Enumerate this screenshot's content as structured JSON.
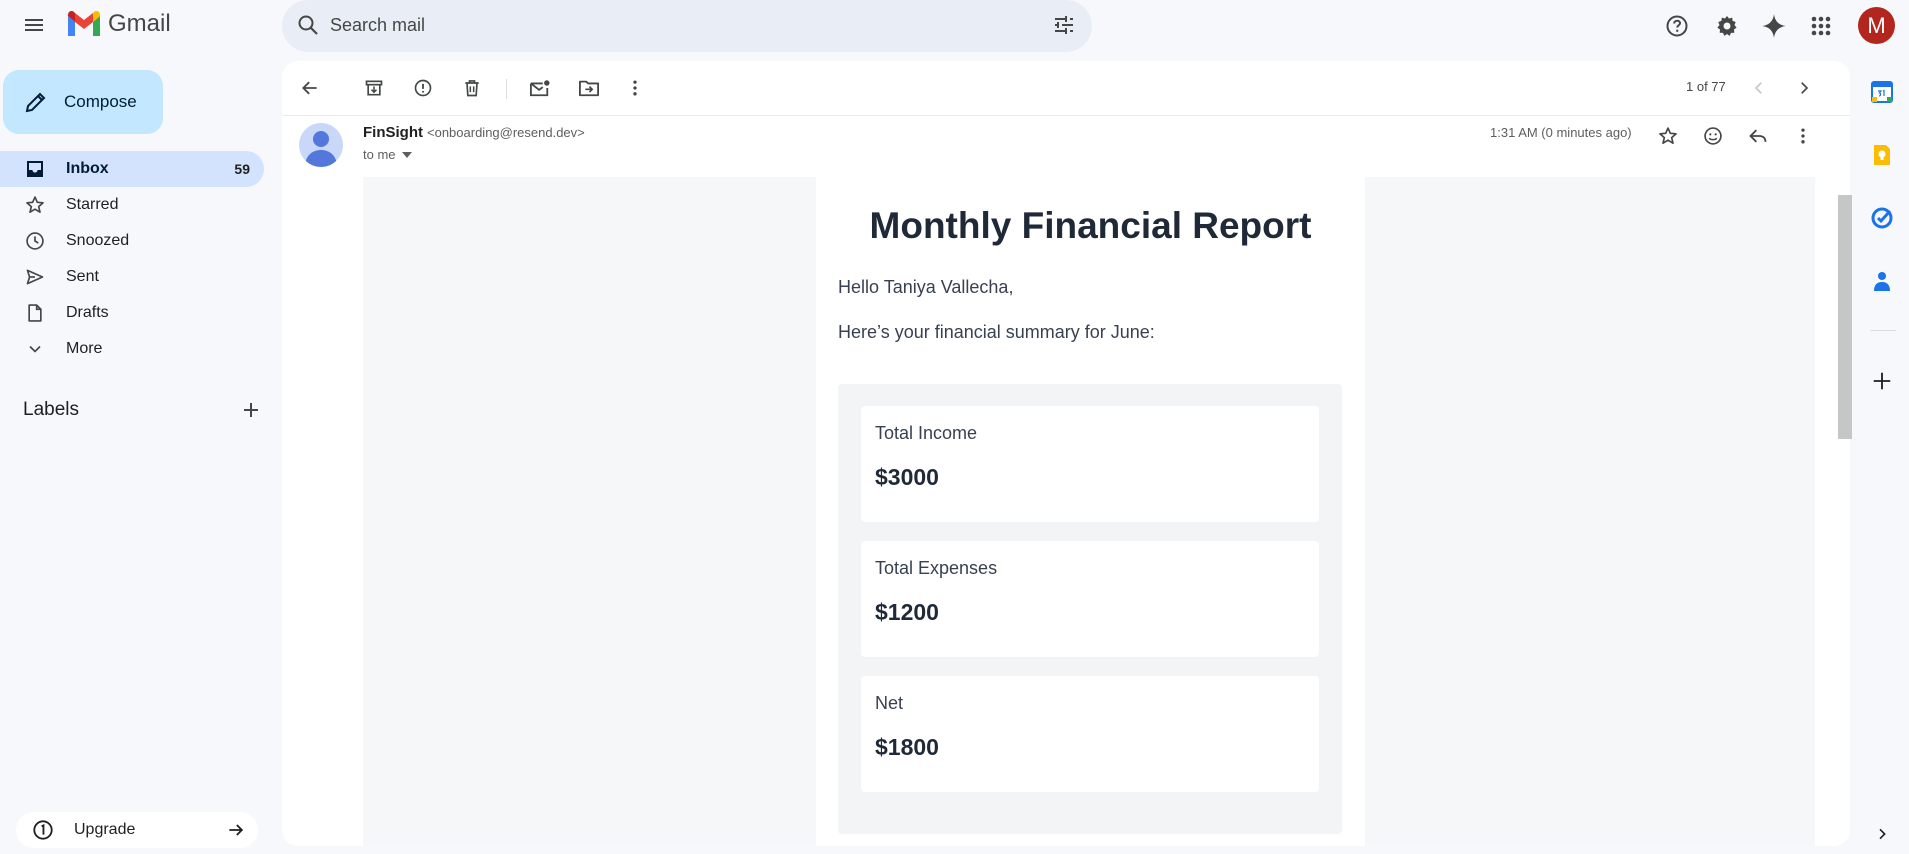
{
  "app": {
    "name": "Gmail"
  },
  "search": {
    "placeholder": "Search mail"
  },
  "account": {
    "initial": "M"
  },
  "compose": {
    "label": "Compose"
  },
  "nav": {
    "items": [
      {
        "label": "Inbox",
        "count": "59",
        "icon": "inbox-icon",
        "active": true
      },
      {
        "label": "Starred",
        "count": "",
        "icon": "star-icon"
      },
      {
        "label": "Snoozed",
        "count": "",
        "icon": "clock-icon"
      },
      {
        "label": "Sent",
        "count": "",
        "icon": "send-icon"
      },
      {
        "label": "Drafts",
        "count": "",
        "icon": "draft-icon"
      },
      {
        "label": "More",
        "count": "",
        "icon": "chevron-down-icon"
      }
    ]
  },
  "labels": {
    "heading": "Labels"
  },
  "upgrade": {
    "label": "Upgrade"
  },
  "toolbar": {
    "pager": "1 of 77"
  },
  "message": {
    "sender_name": "FinSight",
    "sender_email": "<onboarding@resend.dev>",
    "to": "to me",
    "time": "1:31 AM (0 minutes ago)"
  },
  "report": {
    "title": "Monthly Financial Report",
    "greeting": "Hello Taniya Vallecha,",
    "summary": "Here’s your financial summary for June:",
    "stats": [
      {
        "label": "Total Income",
        "value": "$3000"
      },
      {
        "label": "Total Expenses",
        "value": "$1200"
      },
      {
        "label": "Net",
        "value": "$1800"
      }
    ]
  },
  "colors": {
    "background": "#f6f8fc",
    "compose": "#c2e7ff",
    "active_nav": "#d3e3fd",
    "search": "#e9eef6",
    "avatar": "#b3261e"
  }
}
